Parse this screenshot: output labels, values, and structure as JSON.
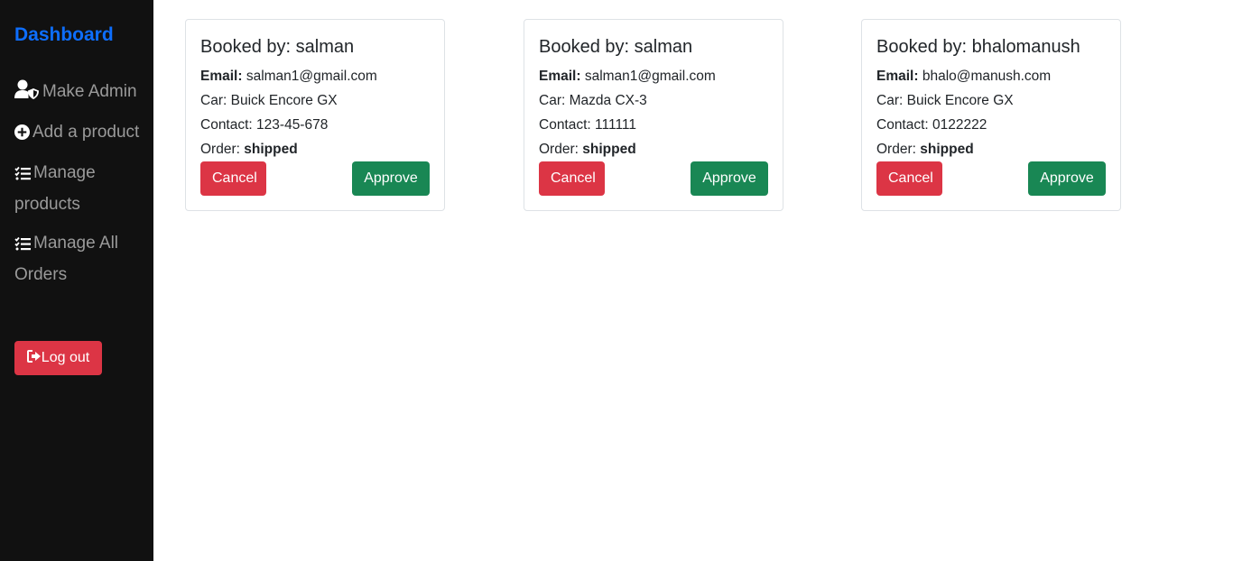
{
  "sidebar": {
    "brand": "Dashboard",
    "items": [
      {
        "label": "Make Admin",
        "icon": "user-shield-icon"
      },
      {
        "label": "Add a product",
        "icon": "plus-circle-icon"
      },
      {
        "label": "Manage products",
        "icon": "list-check-icon"
      },
      {
        "label": "Manage All Orders",
        "icon": "list-check-icon"
      }
    ],
    "logout": {
      "label": "Log out",
      "icon": "sign-out-icon"
    }
  },
  "orders": [
    {
      "title": "Booked by: salman",
      "email_label": "Email:",
      "email": "salman1@gmail.com",
      "car_label": "Car:",
      "car": "Buick Encore GX",
      "contact_label": "Contact:",
      "contact": "123-45-678",
      "order_label": "Order:",
      "status": "shipped",
      "cancel_label": "Cancel",
      "approve_label": "Approve"
    },
    {
      "title": "Booked by: salman",
      "email_label": "Email:",
      "email": "salman1@gmail.com",
      "car_label": "Car:",
      "car": "Mazda CX-3",
      "contact_label": "Contact:",
      "contact": "111111",
      "order_label": "Order:",
      "status": "shipped",
      "cancel_label": "Cancel",
      "approve_label": "Approve"
    },
    {
      "title": "Booked by: bhalomanush",
      "email_label": "Email:",
      "email": "bhalo@manush.com",
      "car_label": "Car:",
      "car": "Buick Encore GX",
      "contact_label": "Contact:",
      "contact": "0122222",
      "order_label": "Order:",
      "status": "shipped",
      "cancel_label": "Cancel",
      "approve_label": "Approve"
    }
  ],
  "colors": {
    "sidebar_bg": "#111111",
    "brand": "#0d6efd",
    "nav_text": "#9a9a9a",
    "danger": "#dc3545",
    "success": "#198754"
  }
}
